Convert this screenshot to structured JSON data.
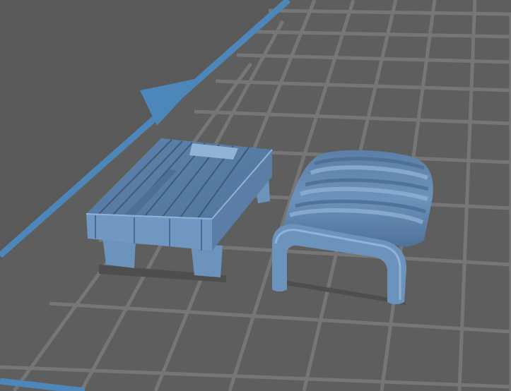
{
  "viewport": {
    "name": "3d-model-viewport",
    "background_color": "#595959",
    "grid_fill_color": "#5e5e5e",
    "grid_line_color": "#767676",
    "axis_color": "#4d86b8",
    "model_color": "#6c93bb",
    "model_shadow_color": "#3f5a78",
    "model_highlight_color": "#90b3d6"
  },
  "objects": [
    {
      "name": "pallet-platform-model",
      "icon": "pallet-model"
    },
    {
      "name": "arched-tunnel-model",
      "icon": "tunnel-model"
    }
  ],
  "axis": {
    "icon": "axis-arrow-icon"
  }
}
